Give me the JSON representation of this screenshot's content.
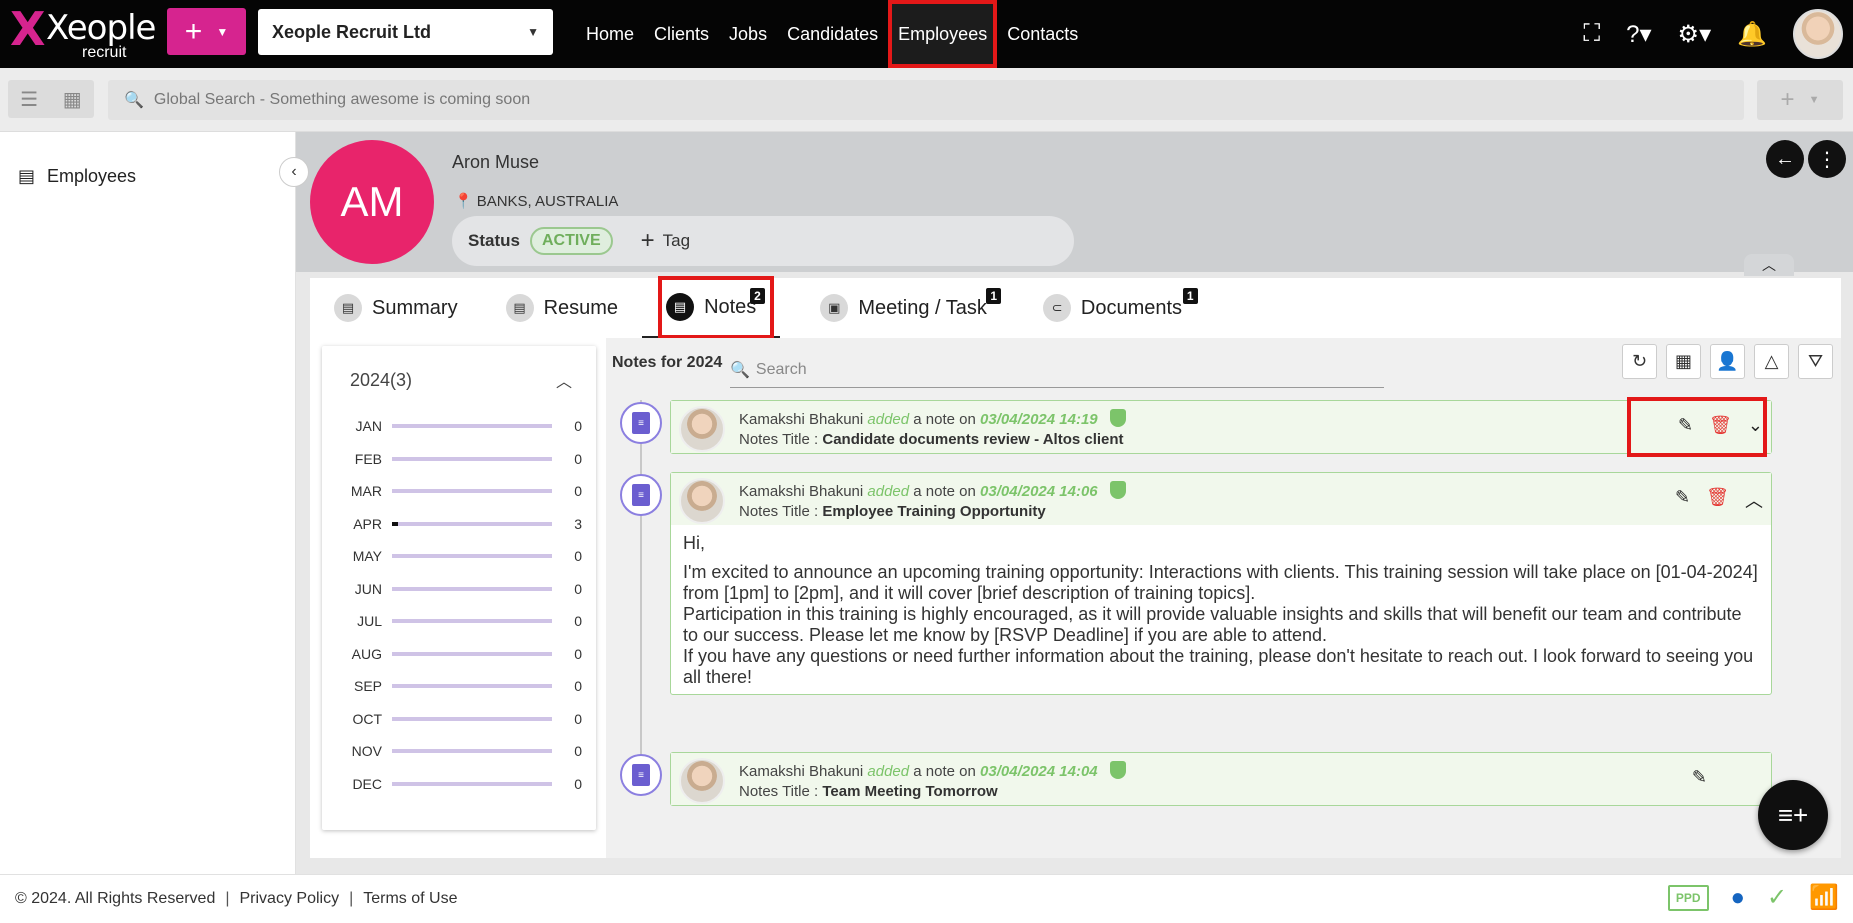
{
  "app": {
    "logo_name": "Xeople",
    "logo_sub": "recruit",
    "company": "Xeople Recruit Ltd"
  },
  "nav": [
    {
      "label": "Home"
    },
    {
      "label": "Clients"
    },
    {
      "label": "Jobs"
    },
    {
      "label": "Candidates"
    },
    {
      "label": "Employees",
      "active": true
    },
    {
      "label": "Contacts"
    }
  ],
  "search": {
    "placeholder": "Global Search - Something awesome is coming soon"
  },
  "sidebar": {
    "items": [
      {
        "label": "Employees"
      }
    ]
  },
  "profile": {
    "initials": "AM",
    "name": "Aron Muse",
    "location": "BANKS, AUSTRALIA",
    "status_label": "Status",
    "status": "ACTIVE",
    "tag_label": "Tag"
  },
  "tabs": [
    {
      "label": "Summary"
    },
    {
      "label": "Resume"
    },
    {
      "label": "Notes",
      "count": "2",
      "active": true
    },
    {
      "label": "Meeting / Task",
      "count": "1"
    },
    {
      "label": "Documents",
      "count": "1"
    }
  ],
  "year_panel": {
    "title": "2024(3)",
    "months": [
      {
        "m": "JAN",
        "v": 0
      },
      {
        "m": "FEB",
        "v": 0
      },
      {
        "m": "MAR",
        "v": 0
      },
      {
        "m": "APR",
        "v": 3
      },
      {
        "m": "MAY",
        "v": 0
      },
      {
        "m": "JUN",
        "v": 0
      },
      {
        "m": "JUL",
        "v": 0
      },
      {
        "m": "AUG",
        "v": 0
      },
      {
        "m": "SEP",
        "v": 0
      },
      {
        "m": "OCT",
        "v": 0
      },
      {
        "m": "NOV",
        "v": 0
      },
      {
        "m": "DEC",
        "v": 0
      }
    ]
  },
  "notes": {
    "heading": "Notes for 2024",
    "search_placeholder": "Search",
    "title_label": "Notes Title :",
    "added_text": "added",
    "note_on_text": "a note on",
    "items": [
      {
        "author": "Kamakshi Bhakuni",
        "date": "03/04/2024 14:19",
        "title": "Candidate documents review - Altos client"
      },
      {
        "author": "Kamakshi Bhakuni",
        "date": "03/04/2024 14:06",
        "title": "Employee Training Opportunity",
        "body": [
          "Hi,",
          "I'm excited to announce an upcoming training opportunity: Interactions with clients. This training session will take place on [01-04-2024] from [1pm] to [2pm], and it will cover [brief description of training topics].",
          "Participation in this training is highly encouraged, as it will provide valuable insights and skills that will benefit our team and contribute to our success. Please let me know by [RSVP Deadline] if you are able to attend.",
          "If you have any questions or need further information about the training, please don't hesitate to reach out. I look forward to seeing you all there!"
        ]
      },
      {
        "author": "Kamakshi Bhakuni",
        "date": "03/04/2024 14:04",
        "title": "Team Meeting Tomorrow"
      }
    ]
  },
  "footer": {
    "copyright": "© 2024. All Rights Reserved",
    "privacy": "Privacy Policy",
    "terms": "Terms of Use",
    "ppd": "PPD"
  }
}
